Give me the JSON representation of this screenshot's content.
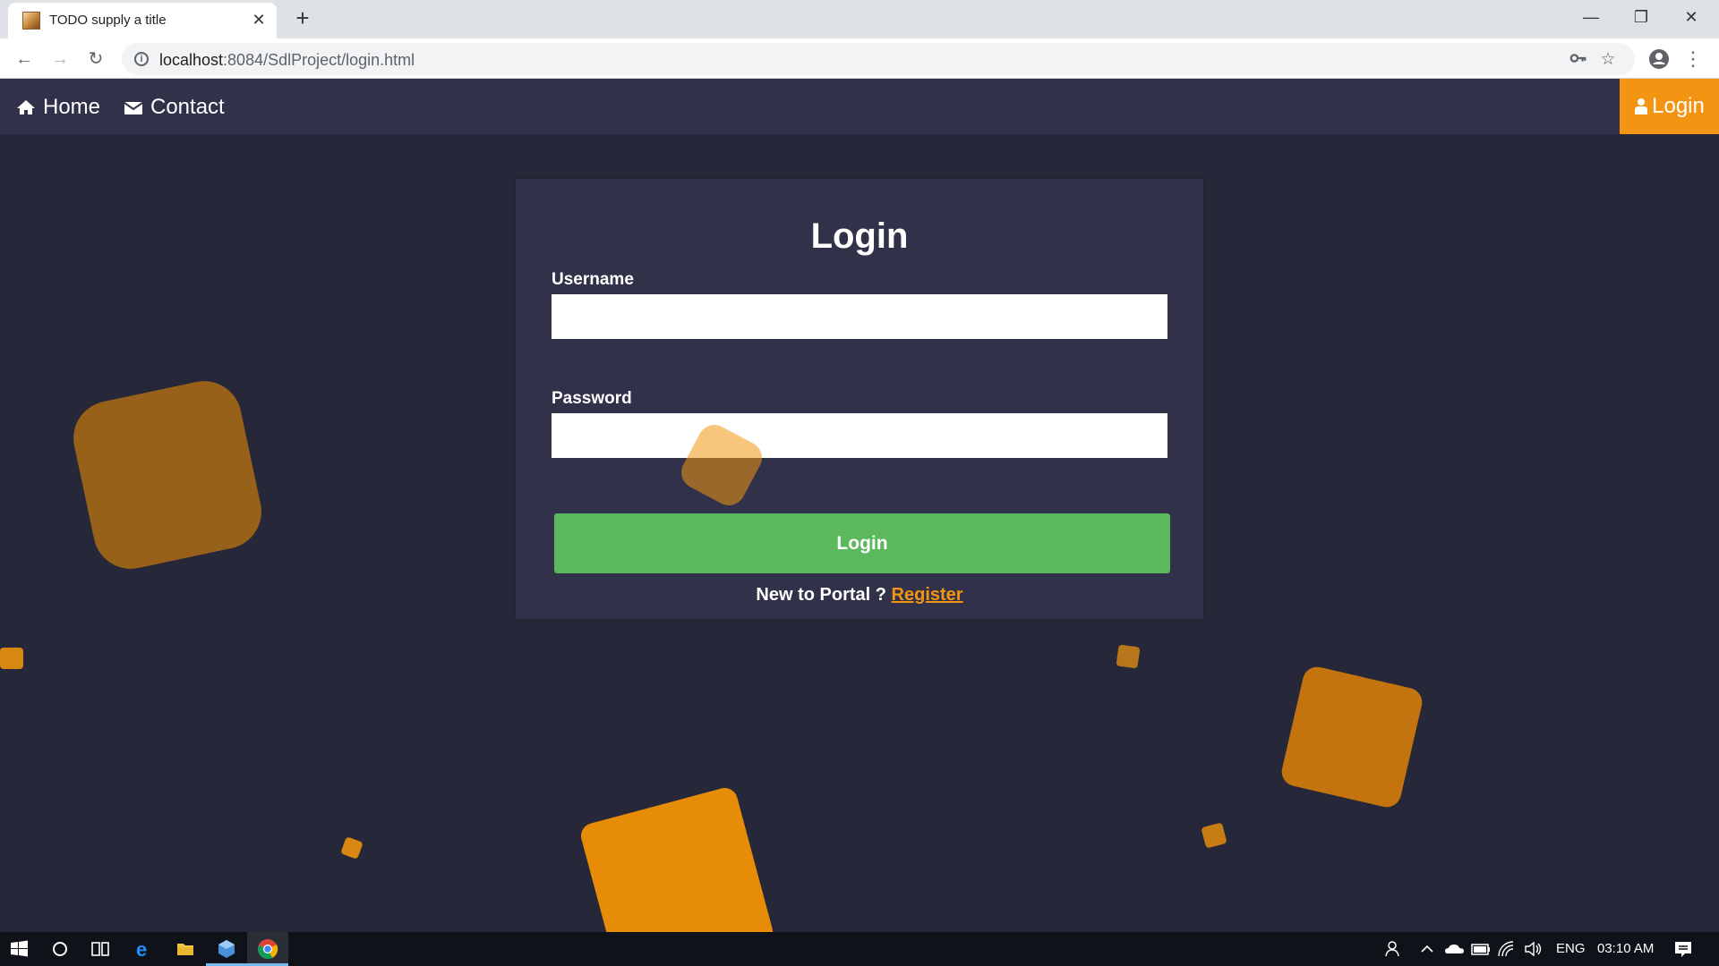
{
  "browser": {
    "tab_title": "TODO supply a title",
    "tab_close": "✕",
    "new_tab": "+",
    "url_host": "localhost",
    "url_rest": ":8084/SdlProject/login.html",
    "window_controls": {
      "minimize": "—",
      "restore": "❐",
      "close": "✕"
    }
  },
  "site_nav": {
    "home_label": "Home",
    "contact_label": "Contact",
    "login_label": "Login",
    "home_icon": "home-icon",
    "contact_icon": "envelope-icon",
    "login_icon": "user-icon",
    "bg_color": "#31324a",
    "accent_color": "#f39512"
  },
  "login_form": {
    "title": "Login",
    "username_label": "Username",
    "username_value": "",
    "password_label": "Password",
    "password_value": "",
    "submit_label": "Login",
    "register_prompt": "New to Portal ? ",
    "register_link": "Register",
    "submit_color": "#5cb85c"
  },
  "taskbar": {
    "language": "ENG",
    "time": "03:10 AM"
  },
  "colors": {
    "page_background": "#262839",
    "card_background": "#31324a",
    "decor_orange": "#f39512"
  }
}
